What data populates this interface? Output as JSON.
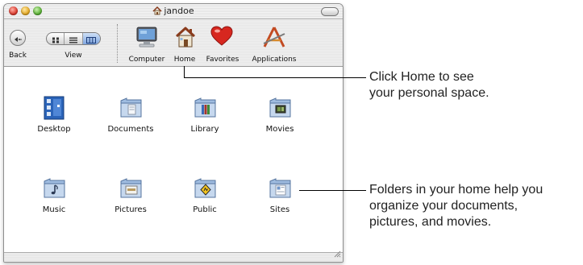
{
  "window": {
    "title": "jandoe"
  },
  "toolbar": {
    "back_label": "Back",
    "view_label": "View",
    "view_modes": [
      "icon-view-icon",
      "list-view-icon",
      "column-view-icon"
    ],
    "active_view": "column",
    "tools": [
      {
        "label": "Computer",
        "icon": "computer-icon"
      },
      {
        "label": "Home",
        "icon": "home-icon"
      },
      {
        "label": "Favorites",
        "icon": "heart-icon"
      },
      {
        "label": "Applications",
        "icon": "applications-icon"
      }
    ]
  },
  "items": [
    {
      "label": "Desktop",
      "icon": "desktop-icon"
    },
    {
      "label": "Documents",
      "icon": "documents-folder-icon"
    },
    {
      "label": "Library",
      "icon": "library-folder-icon"
    },
    {
      "label": "Movies",
      "icon": "movies-folder-icon"
    },
    {
      "label": "Music",
      "icon": "music-folder-icon"
    },
    {
      "label": "Pictures",
      "icon": "pictures-folder-icon"
    },
    {
      "label": "Public",
      "icon": "public-folder-icon"
    },
    {
      "label": "Sites",
      "icon": "sites-folder-icon"
    }
  ],
  "callouts": {
    "home": {
      "line1": "Click Home to see",
      "line2": "your personal space."
    },
    "folders": {
      "line1": "Folders in your home help you",
      "line2": "organize your documents,",
      "line3": "pictures, and movies."
    }
  },
  "colors": {
    "folder_blue": "#8fb0d8",
    "close": "#dd3b2f",
    "minimize": "#e4a824",
    "zoom": "#5bb236"
  }
}
